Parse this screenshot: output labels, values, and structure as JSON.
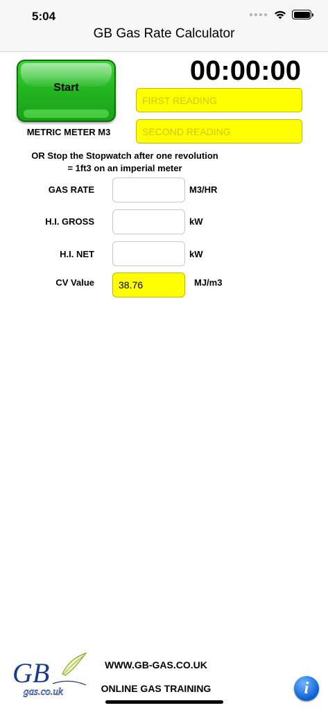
{
  "status_bar": {
    "time": "5:04"
  },
  "nav": {
    "title": "GB Gas Rate Calculator"
  },
  "stopwatch": {
    "start_label": "Start",
    "timer": "00:00:00"
  },
  "readings": {
    "first_placeholder": "FIRST READING",
    "second_placeholder": "SECOND READING",
    "meter_label": "METRIC METER M3"
  },
  "instructions": {
    "line1": "OR Stop the Stopwatch after one revolution",
    "line2": "= 1ft3 on an imperial meter"
  },
  "fields": [
    {
      "label": "GAS RATE",
      "value": "",
      "unit": "M3/HR"
    },
    {
      "label": "H.I. GROSS",
      "value": "",
      "unit": "kW"
    },
    {
      "label": "H.I. NET",
      "value": "",
      "unit": "kW"
    },
    {
      "label": "CV Value",
      "value": "38.76",
      "unit": "MJ/m3"
    }
  ],
  "footer": {
    "logo_text": "GB",
    "logo_subtext": "gas.co.uk",
    "website": "WWW.GB-GAS.CO.UK",
    "tagline": "ONLINE GAS TRAINING",
    "info_label": "i"
  },
  "colors": {
    "start_green": "#22b420",
    "field_yellow": "#ffff00",
    "info_blue": "#0a5fd1"
  }
}
